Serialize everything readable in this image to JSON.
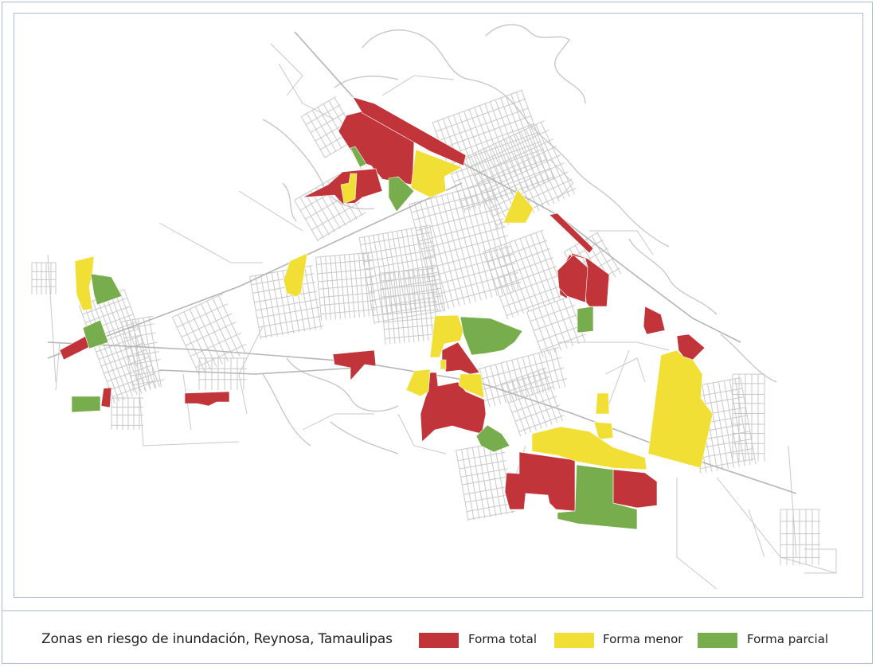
{
  "legend": {
    "title": "Zonas en riesgo de inundación, Reynosa, Tamaulipas",
    "items": [
      {
        "label": "Forma total",
        "color": "#c1353a"
      },
      {
        "label": "Forma menor",
        "color": "#f2df35"
      },
      {
        "label": "Forma parcial",
        "color": "#77ad4c"
      }
    ]
  },
  "map": {
    "street_color": "#c8c8c8",
    "river_color": "#c4c4c4"
  }
}
